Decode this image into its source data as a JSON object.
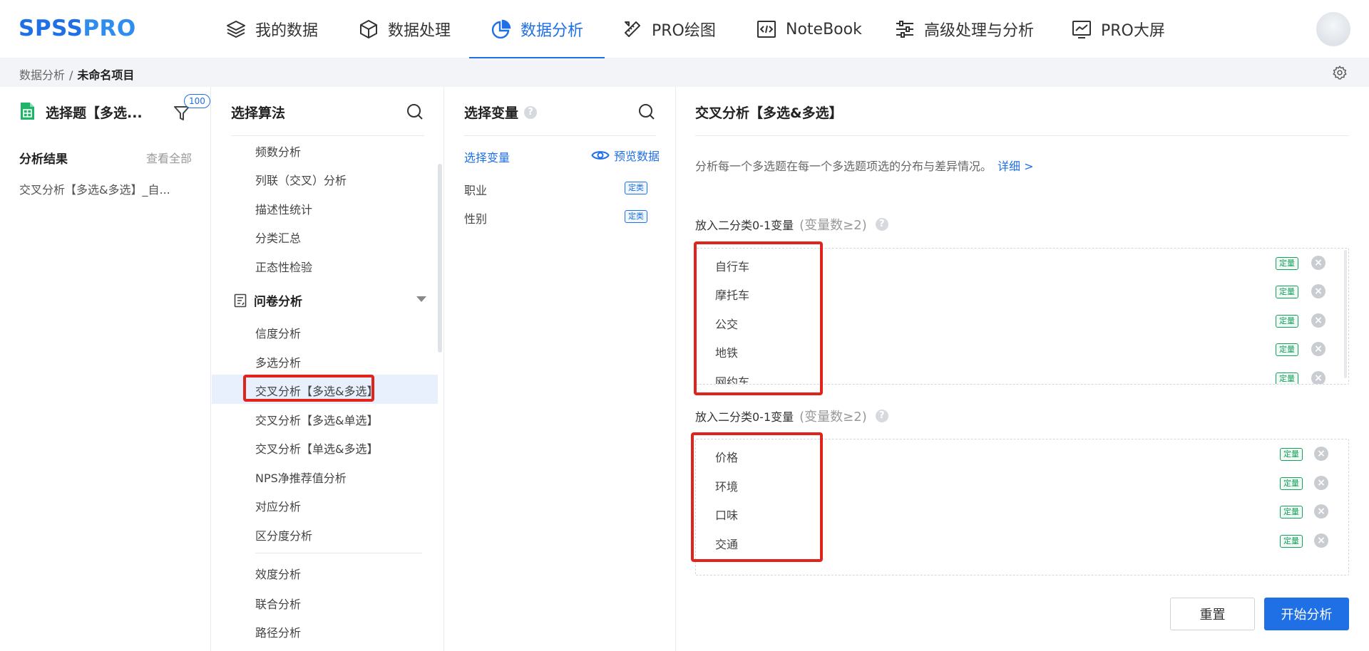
{
  "app": {
    "logo_main": "SPSS",
    "logo_pro": "PRO"
  },
  "nav": {
    "items": [
      {
        "label": "我的数据",
        "icon": "layers-icon"
      },
      {
        "label": "数据处理",
        "icon": "cube-icon"
      },
      {
        "label": "数据分析",
        "icon": "pie-chart-icon",
        "active": true
      },
      {
        "label": "PRO绘图",
        "icon": "ruler-pencil-icon"
      },
      {
        "label": "NoteBook",
        "icon": "code-icon"
      },
      {
        "label": "高级处理与分析",
        "icon": "sliders-icon"
      },
      {
        "label": "PRO大屏",
        "icon": "line-chart-screen-icon"
      }
    ]
  },
  "breadcrumb": {
    "root": "数据分析",
    "separator": "/",
    "current": "未命名项目"
  },
  "left_panel": {
    "file_title": "选择题【多选...",
    "filter_badge": "100",
    "results_title": "分析结果",
    "view_all": "查看全部",
    "result_item": "交叉分析【多选&多选】_自..."
  },
  "algorithm_panel": {
    "title": "选择算法",
    "items_top": [
      "频数分析",
      "列联（交叉）分析",
      "描述性统计",
      "分类汇总",
      "正态性检验"
    ],
    "group_label": "问卷分析",
    "group_items": [
      "信度分析",
      "多选分析",
      "交叉分析【多选&多选】",
      "交叉分析【多选&单选】",
      "交叉分析【单选&多选】",
      "NPS净推荐值分析",
      "对应分析",
      "区分度分析"
    ],
    "selected_index": 2,
    "items_bottom": [
      "效度分析",
      "联合分析",
      "路径分析"
    ]
  },
  "variable_panel": {
    "title": "选择变量",
    "help": "?",
    "tab_label": "选择变量",
    "preview_label": "预览数据",
    "variables": [
      {
        "name": "职业",
        "type": "定类"
      },
      {
        "name": "性别",
        "type": "定类"
      }
    ]
  },
  "config_panel": {
    "title": "交叉分析【多选&多选】",
    "description": "分析每一个多选题在每一个多选题项选的分布与差异情况。",
    "detail_link": "详细 >",
    "slot1": {
      "label": "放入二分类0-1变量",
      "hint": "(变量数≥2)",
      "items": [
        {
          "name": "自行车",
          "type": "定量"
        },
        {
          "name": "摩托车",
          "type": "定量"
        },
        {
          "name": "公交",
          "type": "定量"
        },
        {
          "name": "地铁",
          "type": "定量"
        },
        {
          "name": "网约车",
          "type": "定量"
        }
      ]
    },
    "slot2": {
      "label": "放入二分类0-1变量",
      "hint": "(变量数≥2)",
      "items": [
        {
          "name": "价格",
          "type": "定量"
        },
        {
          "name": "环境",
          "type": "定量"
        },
        {
          "name": "口味",
          "type": "定量"
        },
        {
          "name": "交通",
          "type": "定量"
        }
      ]
    },
    "reset_label": "重置",
    "start_label": "开始分析"
  },
  "colors": {
    "accent": "#1f6fe5",
    "highlight": "#e0241b",
    "quant_tag": "#17a05d"
  }
}
